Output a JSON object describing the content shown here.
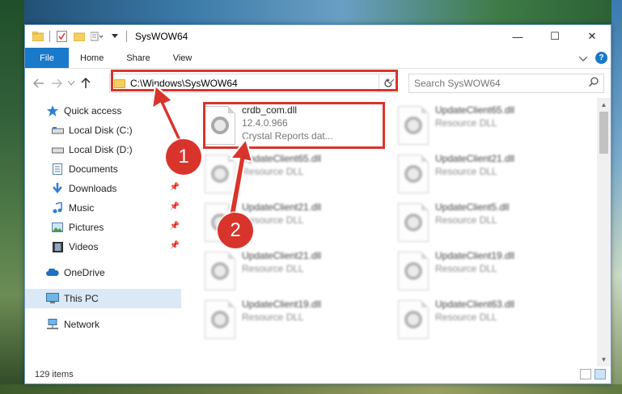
{
  "window": {
    "title": "SysWOW64",
    "controls": {
      "minimize": "—",
      "maximize": "☐",
      "close": "✕"
    }
  },
  "ribbon": {
    "tabs": [
      "File",
      "Home",
      "Share",
      "View"
    ]
  },
  "address": {
    "path": "C:\\Windows\\SysWOW64",
    "search_placeholder": "Search SysWOW64"
  },
  "nav": {
    "items": [
      {
        "label": "Quick access",
        "icon": "star-icon"
      },
      {
        "label": "Local Disk (C:)",
        "icon": "drive-icon"
      },
      {
        "label": "Local Disk (D:)",
        "icon": "drive-icon"
      },
      {
        "label": "Documents",
        "icon": "documents-icon",
        "pinned": true
      },
      {
        "label": "Downloads",
        "icon": "download-icon",
        "pinned": true
      },
      {
        "label": "Music",
        "icon": "music-icon",
        "pinned": true
      },
      {
        "label": "Pictures",
        "icon": "pictures-icon",
        "pinned": true
      },
      {
        "label": "Videos",
        "icon": "videos-icon",
        "pinned": true
      },
      {
        "label": "OneDrive",
        "icon": "cloud-icon"
      },
      {
        "label": "This PC",
        "icon": "pc-icon",
        "selected": true
      },
      {
        "label": "Network",
        "icon": "network-icon"
      }
    ]
  },
  "files": [
    {
      "name": "crdb_com.dll",
      "version": "12.4.0.966",
      "desc": "Crystal Reports dat..."
    },
    {
      "name": "UpdateClient65.dll",
      "desc": "Resource DLL"
    },
    {
      "name": "UpdateClient65.dll",
      "desc": "Resource DLL"
    },
    {
      "name": "UpdateClient21.dll",
      "desc": "Resource DLL"
    },
    {
      "name": "UpdateClient21.dll",
      "desc": "Resource DLL"
    },
    {
      "name": "UpdateClient5.dll",
      "desc": "Resource DLL"
    },
    {
      "name": "UpdateClient21.dll",
      "desc": "Resource DLL"
    },
    {
      "name": "UpdateClient19.dll",
      "desc": "Resource DLL"
    },
    {
      "name": "UpdateClient19.dll",
      "desc": "Resource DLL"
    },
    {
      "name": "UpdateClient63.dll",
      "desc": "Resource DLL"
    }
  ],
  "status": {
    "item_count": "129 items"
  },
  "callouts": [
    "1",
    "2"
  ],
  "colors": {
    "accent": "#1979ca",
    "highlight": "#d9342b",
    "selection": "#dbe9f7"
  }
}
